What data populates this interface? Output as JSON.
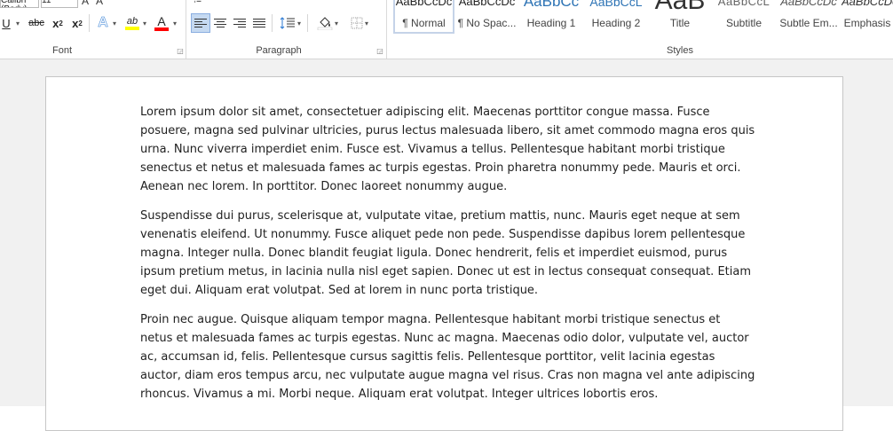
{
  "ribbon": {
    "font_group": {
      "label": "Font",
      "font_name_value": "Calibri (Body)",
      "font_size_value": "11",
      "underline_label": "U",
      "strikethrough_label": "abc",
      "subscript_label": "x",
      "subscript_mark": "2",
      "superscript_label": "x",
      "superscript_mark": "2",
      "text_effects_label": "A",
      "highlight_label": "ab",
      "font_color_label": "A",
      "highlight_color": "#ffff00",
      "font_color": "#ff0000"
    },
    "paragraph_group": {
      "label": "Paragraph"
    },
    "styles_group": {
      "label": "Styles",
      "styles": [
        {
          "sample": "AaBbCcDc",
          "name": "¶ Normal"
        },
        {
          "sample": "AaBbCcDc",
          "name": "¶ No Spac..."
        },
        {
          "sample": "AaBbCc",
          "name": "Heading 1"
        },
        {
          "sample": "AaBbCcL",
          "name": "Heading 2"
        },
        {
          "sample": "AaB",
          "name": "Title"
        },
        {
          "sample": "AaBbCcL",
          "name": "Subtitle"
        },
        {
          "sample": "AaBbCcDc",
          "name": "Subtle Em..."
        },
        {
          "sample": "AaBbCcDc",
          "name": "Emphasis"
        }
      ]
    }
  },
  "document": {
    "paragraphs": [
      "Lorem ipsum dolor sit amet, consectetuer adipiscing elit. Maecenas porttitor congue massa. Fusce posuere, magna sed pulvinar ultricies, purus lectus malesuada libero, sit amet commodo magna eros quis urna. Nunc viverra imperdiet enim. Fusce est. Vivamus a tellus. Pellentesque habitant morbi tristique senectus et netus et malesuada fames ac turpis egestas. Proin pharetra nonummy pede. Mauris et orci. Aenean nec lorem. In porttitor. Donec laoreet nonummy augue.",
      "Suspendisse dui purus, scelerisque at, vulputate vitae, pretium mattis, nunc. Mauris eget neque at sem venenatis eleifend. Ut nonummy. Fusce aliquet pede non pede. Suspendisse dapibus lorem pellentesque magna. Integer nulla. Donec blandit feugiat ligula. Donec hendrerit, felis et imperdiet euismod, purus ipsum pretium metus, in lacinia nulla nisl eget sapien. Donec ut est in lectus consequat consequat. Etiam eget dui. Aliquam erat volutpat. Sed at lorem in nunc porta tristique.",
      "Proin nec augue. Quisque aliquam tempor magna. Pellentesque habitant morbi tristique senectus et netus et malesuada fames ac turpis egestas. Nunc ac magna. Maecenas odio dolor, vulputate vel, auctor ac, accumsan id, felis. Pellentesque cursus sagittis felis. Pellentesque porttitor, velit lacinia egestas auctor, diam eros tempus arcu, nec vulputate augue magna vel risus. Cras non magna vel ante adipiscing rhoncus. Vivamus a mi. Morbi neque. Aliquam erat volutpat. Integer ultrices lobortis eros."
    ]
  }
}
